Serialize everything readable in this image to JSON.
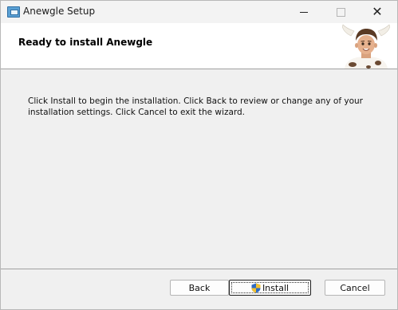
{
  "window": {
    "title": "Anewgle Setup",
    "controls": {
      "minimize": "minimize",
      "maximize": "maximize",
      "close": "✕"
    }
  },
  "banner": {
    "title": "Ready to install Anewgle"
  },
  "main": {
    "instructions": "Click Install to begin the installation. Click Back to review or change any of your installation settings. Click Cancel to exit the wizard."
  },
  "buttons": {
    "back": "Back",
    "install": "Install",
    "cancel": "Cancel"
  },
  "icons": {
    "app": "installer-icon",
    "install_shield": "uac-shield-icon",
    "mascot": "bull-mascot-image"
  }
}
